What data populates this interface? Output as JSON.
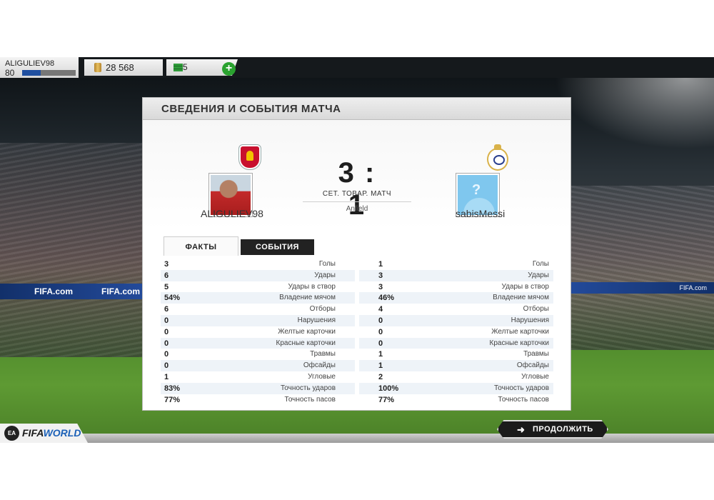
{
  "topbar": {
    "player_name": "ALIGULIEV98",
    "level": "80",
    "xp_progress": 0.35,
    "coins": "28 568",
    "points": "5",
    "add_label": "+"
  },
  "panel": {
    "title": "СВЕДЕНИЯ И СОБЫТИЯ МАТЧА",
    "home_team": "ALIGULIEV98",
    "away_team": "sabisMessi",
    "score": "3 : 1",
    "match_type": "СЕТ. ТОВАР. МАТЧ",
    "venue": "Anfield",
    "tabs": [
      {
        "label": "ФАКТЫ",
        "active": true
      },
      {
        "label": "СОБЫТИЯ",
        "active": false
      }
    ],
    "stats": [
      {
        "home": "3",
        "label": "Голы",
        "away": "1"
      },
      {
        "home": "6",
        "label": "Удары",
        "away": "3"
      },
      {
        "home": "5",
        "label": "Удары в створ",
        "away": "3"
      },
      {
        "home": "54%",
        "label": "Владение мячом",
        "away": "46%"
      },
      {
        "home": "6",
        "label": "Отборы",
        "away": "4"
      },
      {
        "home": "0",
        "label": "Нарушения",
        "away": "0"
      },
      {
        "home": "0",
        "label": "Желтые карточки",
        "away": "0"
      },
      {
        "home": "0",
        "label": "Красные карточки",
        "away": "0"
      },
      {
        "home": "0",
        "label": "Травмы",
        "away": "1"
      },
      {
        "home": "0",
        "label": "Офсайды",
        "away": "1"
      },
      {
        "home": "1",
        "label": "Угловые",
        "away": "2"
      },
      {
        "home": "83%",
        "label": "Точность ударов",
        "away": "100%"
      },
      {
        "home": "77%",
        "label": "Точность пасов",
        "away": "77%"
      }
    ]
  },
  "bottom": {
    "continue_label": "ПРОДОЛЖИТЬ",
    "continue_icon": "arrow-right-icon",
    "logo_ea": "EA SPORTS",
    "logo_fifa": "FIFA",
    "logo_world": "WORLD"
  }
}
